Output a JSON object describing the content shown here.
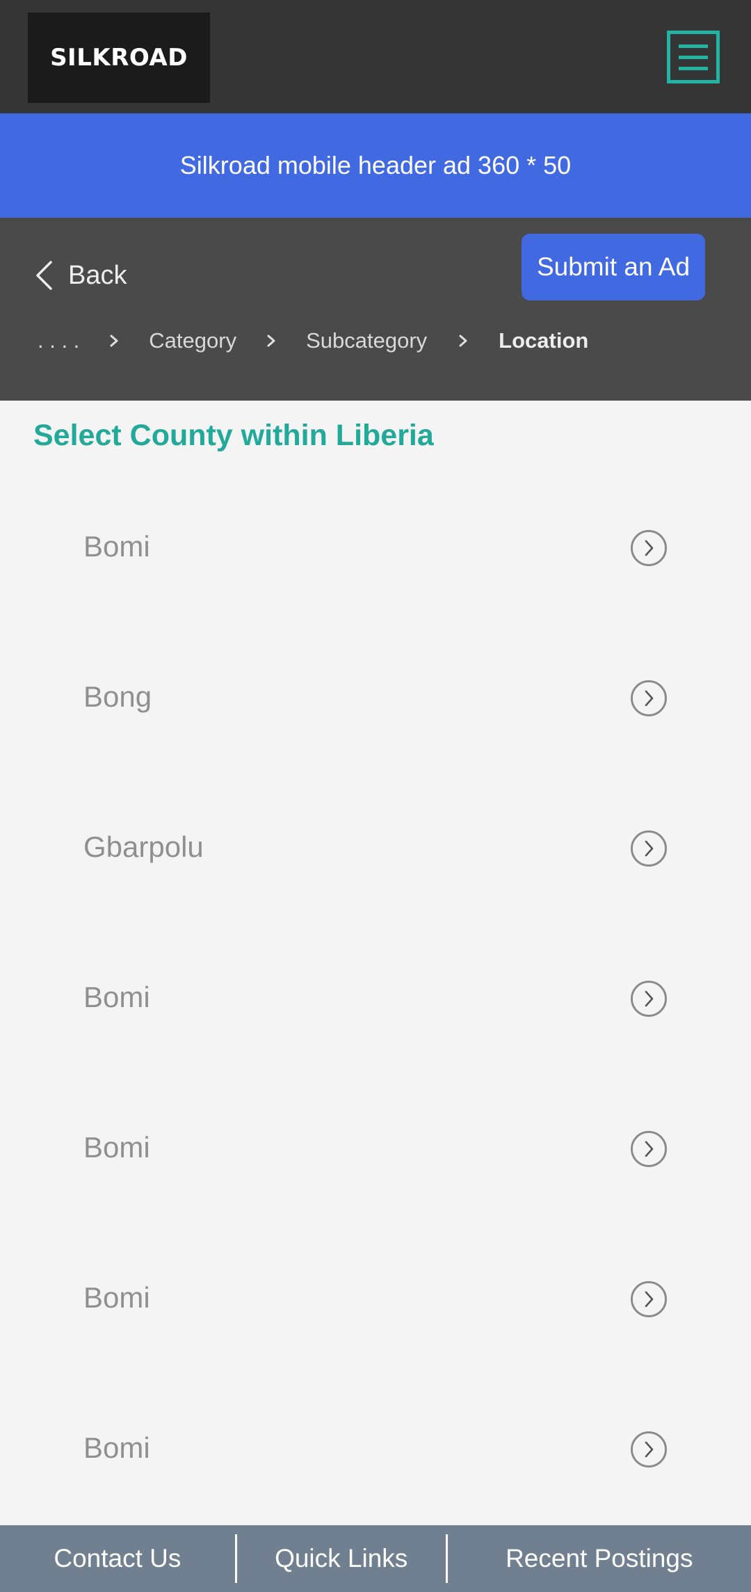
{
  "header": {
    "logo_text": "SILKROAD",
    "menu_icon": "hamburger-menu-icon",
    "accent_color": "#22b3a4"
  },
  "ad_banner": {
    "text": "Silkroad mobile header ad 360 * 50",
    "color": "#4169e1"
  },
  "nav": {
    "back_label": "Back",
    "submit_label": "Submit an Ad",
    "breadcrumb": [
      {
        "label": ". . . .",
        "current": false
      },
      {
        "label": "Category",
        "current": false
      },
      {
        "label": "Subcategory",
        "current": false
      },
      {
        "label": "Location",
        "current": true
      }
    ]
  },
  "main": {
    "title": "Select County within Liberia",
    "title_color": "#22a99a",
    "counties": [
      {
        "name": "Bomi"
      },
      {
        "name": "Bong"
      },
      {
        "name": "Gbarpolu"
      },
      {
        "name": "Bomi"
      },
      {
        "name": "Bomi"
      },
      {
        "name": "Bomi"
      },
      {
        "name": "Bomi"
      }
    ]
  },
  "footer": {
    "links": [
      "Contact Us",
      "Quick Links",
      "Recent Postings"
    ],
    "color": "#708090"
  }
}
